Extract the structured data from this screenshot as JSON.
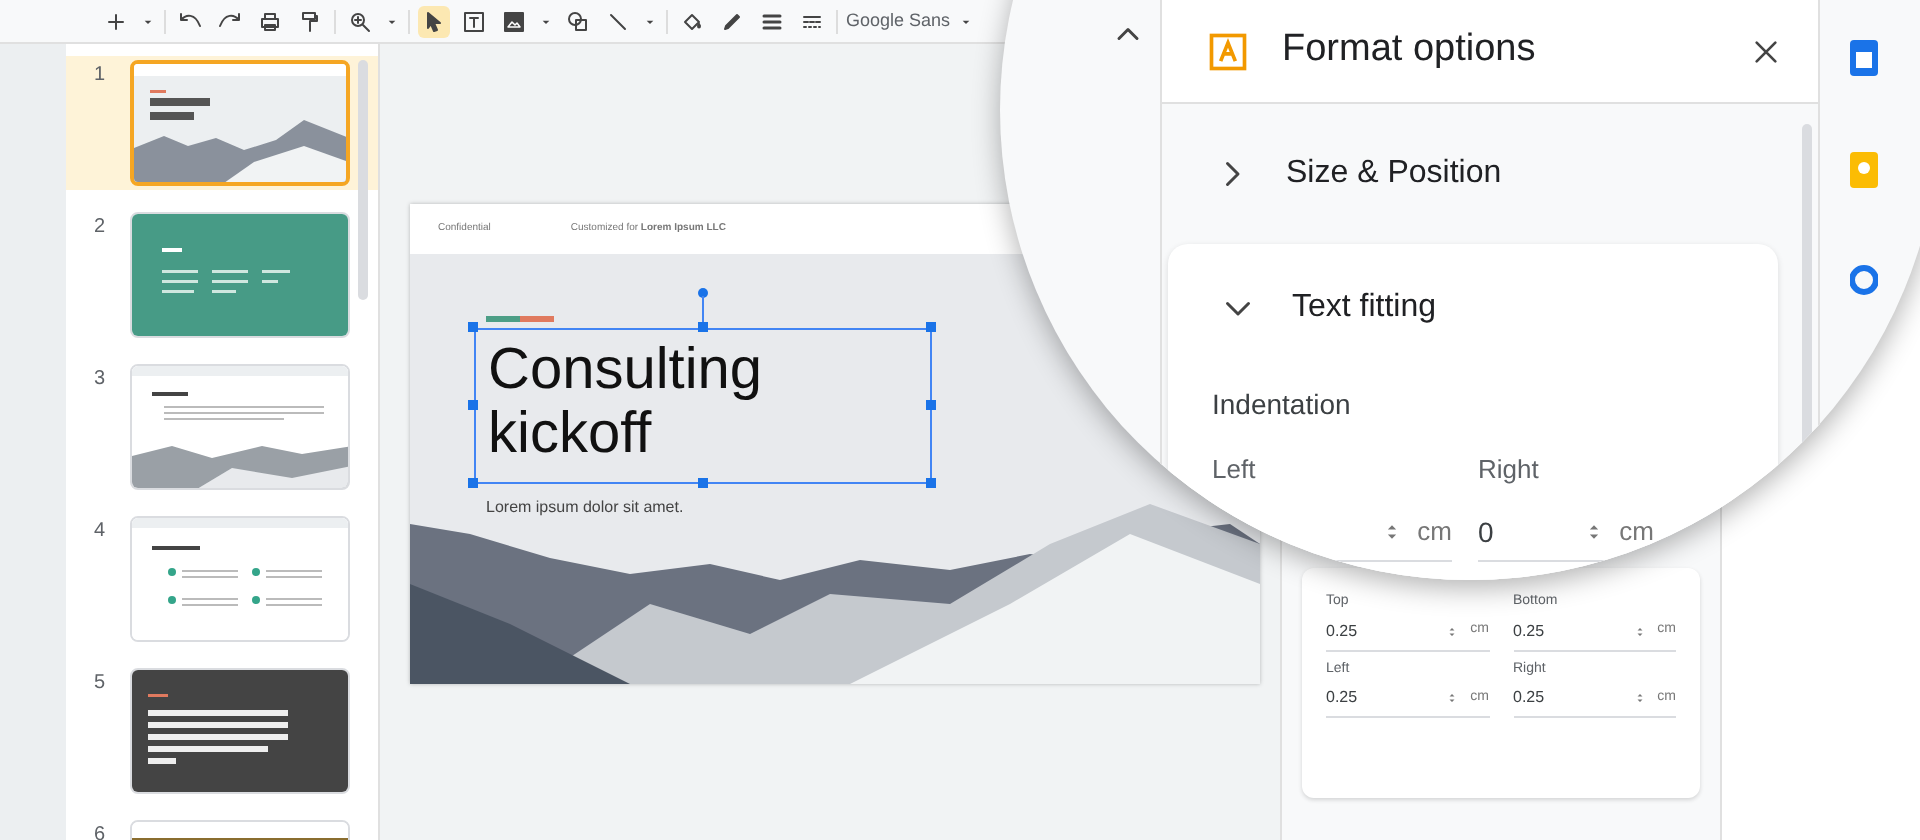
{
  "toolbar": {
    "tools": [
      {
        "kind": "plus",
        "selected": false
      },
      {
        "kind": "undo",
        "selected": false
      },
      {
        "kind": "redo",
        "selected": false
      },
      {
        "kind": "print",
        "selected": false
      },
      {
        "kind": "paint",
        "selected": false
      },
      {
        "kind": "zoom",
        "selected": false
      },
      {
        "kind": "cursor",
        "selected": true
      },
      {
        "kind": "textbox",
        "selected": false
      },
      {
        "kind": "image",
        "selected": false
      },
      {
        "kind": "shape",
        "selected": false
      },
      {
        "kind": "line",
        "selected": false
      },
      {
        "kind": "fill",
        "selected": false
      },
      {
        "kind": "pen",
        "selected": false
      },
      {
        "kind": "weight",
        "selected": false
      },
      {
        "kind": "dash",
        "selected": false
      }
    ],
    "font_name": "Google Sans"
  },
  "slides": [
    {
      "number": "1",
      "selected": true,
      "kind": "title"
    },
    {
      "number": "2",
      "selected": false,
      "kind": "teal"
    },
    {
      "number": "3",
      "selected": false,
      "kind": "photo"
    },
    {
      "number": "4",
      "selected": false,
      "kind": "list"
    },
    {
      "number": "5",
      "selected": false,
      "kind": "dark"
    },
    {
      "number": "6",
      "selected": false,
      "kind": "image"
    }
  ],
  "slide": {
    "header_left": "Confidential",
    "header_right": "Customized for **Lorem Ipsum LLC**",
    "title_lines": [
      "Consulting",
      "kickoff"
    ],
    "subtitle": "Lorem ipsum dolor sit amet."
  },
  "format_panel": {
    "title": "Format options",
    "sections": [
      {
        "label": "Size & Position",
        "expanded": false
      },
      {
        "label": "Text fitting",
        "expanded": true
      }
    ],
    "indentation": {
      "heading": "Indentation",
      "fields": [
        {
          "label": "Left",
          "unit": "cm"
        },
        {
          "label": "Right",
          "value": "0",
          "unit": "cm"
        }
      ]
    },
    "padding_fields": [
      {
        "label": "Top",
        "value": "0.25",
        "unit": "cm"
      },
      {
        "label": "Bottom",
        "value": "0.25",
        "unit": "cm"
      },
      {
        "label": "Left",
        "value": "0.25",
        "unit": "cm"
      },
      {
        "label": "Right",
        "value": "0.25",
        "unit": "cm"
      }
    ]
  }
}
